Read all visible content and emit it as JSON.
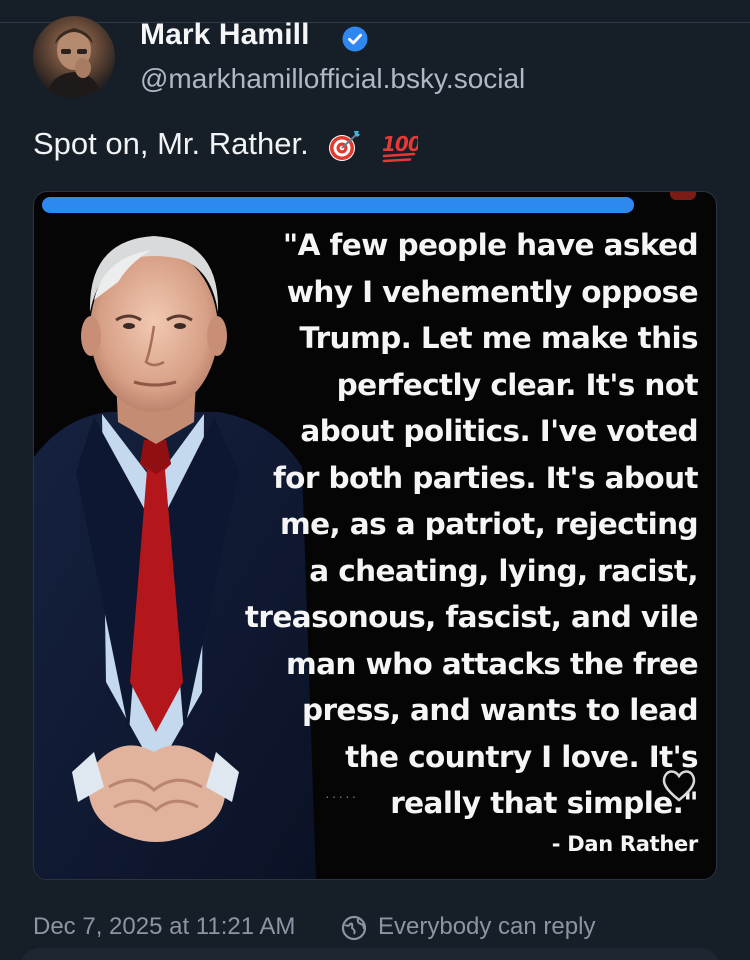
{
  "post": {
    "author_name": "Mark Hamill",
    "author_handle": "@markhamillofficial.bsky.social",
    "text": "Spot on, Mr. Rather.",
    "text_emojis": [
      "direct-hit-icon",
      "hundred-points-icon"
    ],
    "timestamp": "Dec 7, 2025 at 11:21 AM",
    "reply_setting": "Everybody can reply"
  },
  "embed": {
    "quote_lines": "\"A few people have asked\nwhy I vehemently oppose\nTrump. Let me make this\nperfectly clear. It's not\nabout politics. I've voted\nfor both parties. It's about\nme, as a patriot, rejecting\na cheating, lying, racist,\ntreasonous, fascist, and vile\nman who attacks the free\npress, and wants to lead\nthe country I love. It's\nreally that simple.\"",
    "attribution": "- Dan Rather"
  },
  "colors": {
    "background": "#161e27",
    "verified_blue": "#2f87f0",
    "tie_red": "#b3161b",
    "muted_text": "#8a96a3"
  }
}
